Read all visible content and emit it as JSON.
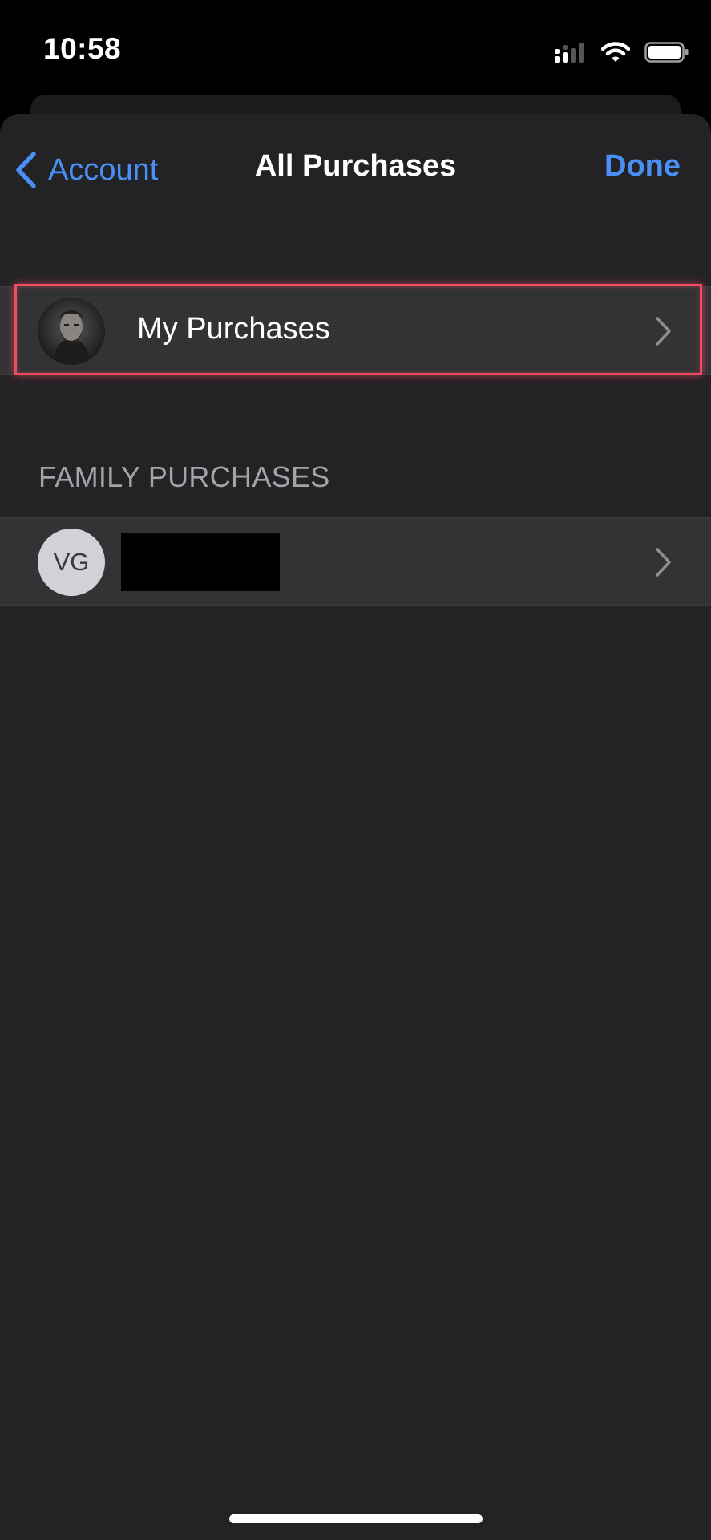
{
  "status_bar": {
    "time": "10:58",
    "icons": [
      "cellular-signal-icon",
      "wifi-icon",
      "battery-icon"
    ]
  },
  "nav": {
    "back_label": "Account",
    "title": "All Purchases",
    "done_label": "Done"
  },
  "my_purchases": {
    "label": "My Purchases",
    "avatar_icon": "user-photo-avatar"
  },
  "family_section": {
    "header": "FAMILY PURCHASES",
    "members": [
      {
        "initials": "VG",
        "name_redacted": true
      }
    ]
  },
  "colors": {
    "accent": "#4a8ff5",
    "sheet_background": "#232325",
    "row_background": "#333335",
    "highlight": "#f04b5e"
  }
}
